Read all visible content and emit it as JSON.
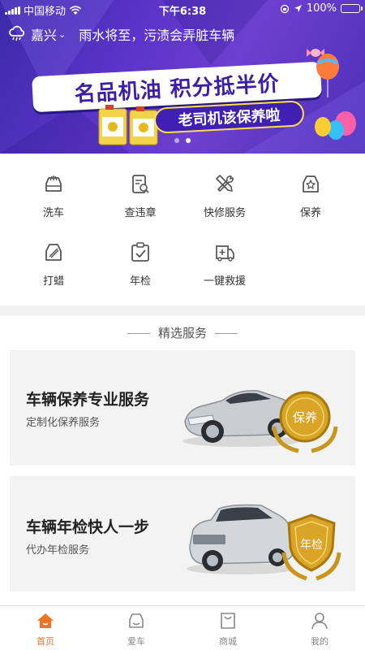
{
  "status_bar": {
    "carrier": "中国移动",
    "time": "下午6:38",
    "battery": "100%",
    "wifi_icon": "wifi-icon",
    "location_icon": "location-arrow-icon",
    "lock_icon": "orientation-lock-icon"
  },
  "header": {
    "weather_icon": "rain-cloud-icon",
    "city": "嘉兴",
    "weather_message": "雨水将至，污渍会弄脏车辆"
  },
  "banner": {
    "headline": "名品机油 积分抵半价",
    "subline": "老司机该保养啦",
    "page_count": 2,
    "active_page": 2
  },
  "services": [
    {
      "label": "洗车",
      "icon": "car-wash-icon"
    },
    {
      "label": "查违章",
      "icon": "violation-search-icon"
    },
    {
      "label": "快修服务",
      "icon": "repair-tools-icon"
    },
    {
      "label": "保养",
      "icon": "maintenance-car-icon"
    },
    {
      "label": "打蜡",
      "icon": "wax-icon"
    },
    {
      "label": "年检",
      "icon": "inspection-clipboard-icon"
    },
    {
      "label": "一键救援",
      "icon": "rescue-truck-icon"
    }
  ],
  "featured": {
    "section_title": "精选服务",
    "cards": [
      {
        "title": "车辆保养专业服务",
        "subtitle": "定制化保养服务",
        "badge": "保养"
      },
      {
        "title": "车辆年检快人一步",
        "subtitle": "代办年检服务",
        "badge": "年检"
      }
    ]
  },
  "tabbar": {
    "tabs": [
      {
        "label": "首页",
        "icon": "home-icon",
        "active": true
      },
      {
        "label": "爱车",
        "icon": "car-icon",
        "active": false
      },
      {
        "label": "商城",
        "icon": "shopping-bag-icon",
        "active": false
      },
      {
        "label": "我的",
        "icon": "user-icon",
        "active": false
      }
    ]
  },
  "colors": {
    "accent": "#f0731f",
    "banner_purple": "#5b34c9",
    "icon_gray": "#555555"
  }
}
